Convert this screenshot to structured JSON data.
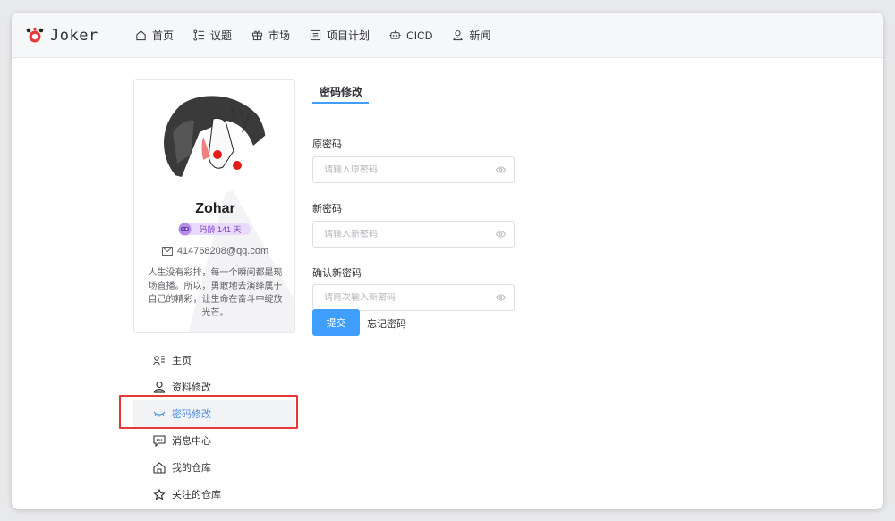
{
  "app": {
    "logo_text": "Joker"
  },
  "nav": {
    "items": [
      {
        "label": "首页",
        "icon": "home-icon"
      },
      {
        "label": "议题",
        "icon": "list-icon"
      },
      {
        "label": "市场",
        "icon": "gift-icon"
      },
      {
        "label": "项目计划",
        "icon": "calendar-icon"
      },
      {
        "label": "CICD",
        "icon": "robot-icon"
      },
      {
        "label": "新闻",
        "icon": "user-icon"
      }
    ]
  },
  "profile": {
    "name": "Zohar",
    "badge": "码龄 141 天",
    "email": "414768208@qq.com",
    "bio": "人生没有彩排，每一个瞬间都是现场直播。所以，勇敢地去演绎属于自己的精彩，让生命在奋斗中绽放光芒。"
  },
  "side_menu": {
    "items": [
      {
        "label": "主页",
        "icon": "id-card-icon"
      },
      {
        "label": "资料修改",
        "icon": "person-icon"
      },
      {
        "label": "密码修改",
        "icon": "closed-eye-icon",
        "active": true
      },
      {
        "label": "消息中心",
        "icon": "message-icon"
      },
      {
        "label": "我的仓库",
        "icon": "house-icon"
      },
      {
        "label": "关注的仓库",
        "icon": "star-house-icon"
      }
    ]
  },
  "form": {
    "tab_title": "密码修改",
    "old_password": {
      "label": "原密码",
      "placeholder": "请输入原密码",
      "value": ""
    },
    "new_password": {
      "label": "新密码",
      "placeholder": "请输入新密码",
      "value": ""
    },
    "confirm_password": {
      "label": "确认新密码",
      "placeholder": "请再次输入新密码",
      "value": ""
    },
    "submit_label": "提交",
    "forgot_label": "忘记密码"
  },
  "colors": {
    "accent": "#409eff",
    "highlight": "#e53935",
    "badge_bg": "#e9d9fb"
  }
}
